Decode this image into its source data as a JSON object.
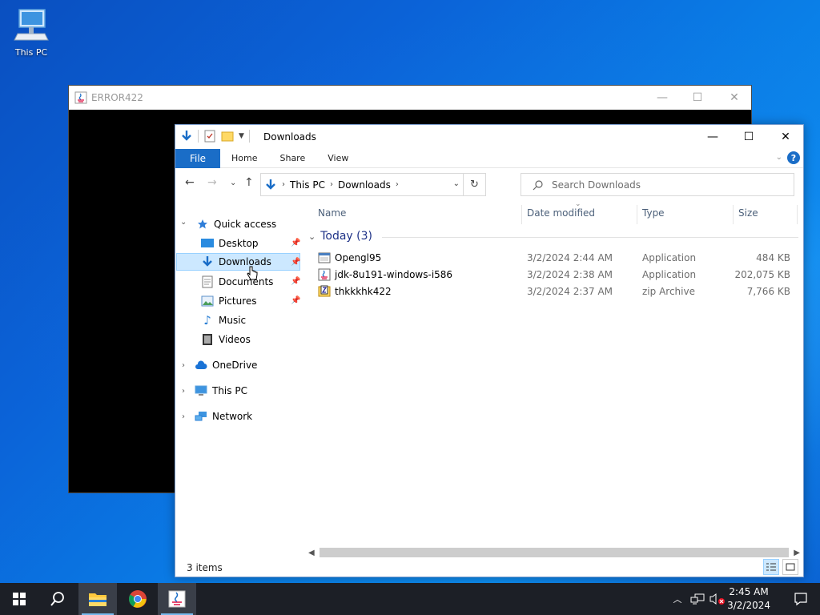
{
  "desktop": {
    "icons": [
      {
        "label": "This PC",
        "icon": "this-pc-icon"
      }
    ]
  },
  "background_window": {
    "title": "ERROR422",
    "controls": {
      "minimize": "—",
      "maximize": "☐",
      "close": "✕"
    }
  },
  "explorer": {
    "title": "Downloads",
    "controls": {
      "minimize": "—",
      "maximize": "☐",
      "close": "✕"
    },
    "ribbon": {
      "file": "File",
      "tabs": [
        "Home",
        "Share",
        "View"
      ],
      "help": "?"
    },
    "address": {
      "crumbs": [
        "This PC",
        "Downloads"
      ]
    },
    "search": {
      "placeholder": "Search Downloads"
    },
    "nav": {
      "quick_access": "Quick access",
      "items": [
        {
          "label": "Desktop",
          "pinned": true
        },
        {
          "label": "Downloads",
          "pinned": true,
          "selected": true
        },
        {
          "label": "Documents",
          "pinned": true
        },
        {
          "label": "Pictures",
          "pinned": true
        },
        {
          "label": "Music",
          "pinned": false
        },
        {
          "label": "Videos",
          "pinned": false
        }
      ],
      "roots": [
        "OneDrive",
        "This PC",
        "Network"
      ]
    },
    "columns": [
      "Name",
      "Date modified",
      "Type",
      "Size"
    ],
    "group": {
      "label": "Today (3)"
    },
    "files": [
      {
        "name": "Opengl95",
        "date": "3/2/2024 2:44 AM",
        "type": "Application",
        "size": "484 KB",
        "icon": "application-icon"
      },
      {
        "name": "jdk-8u191-windows-i586",
        "date": "3/2/2024 2:38 AM",
        "type": "Application",
        "size": "202,075 KB",
        "icon": "java-installer-icon"
      },
      {
        "name": "thkkkhk422",
        "date": "3/2/2024 2:37 AM",
        "type": "zip Archive",
        "size": "7,766 KB",
        "icon": "zip-archive-icon"
      }
    ],
    "status": "3 items"
  },
  "taskbar": {
    "clock": {
      "time": "2:45 AM",
      "date": "3/2/2024"
    }
  },
  "colors": {
    "accent": "#1a6dc7",
    "selection": "#cce8ff",
    "taskbar": "#1c1f26",
    "group_header": "#1e3287"
  }
}
